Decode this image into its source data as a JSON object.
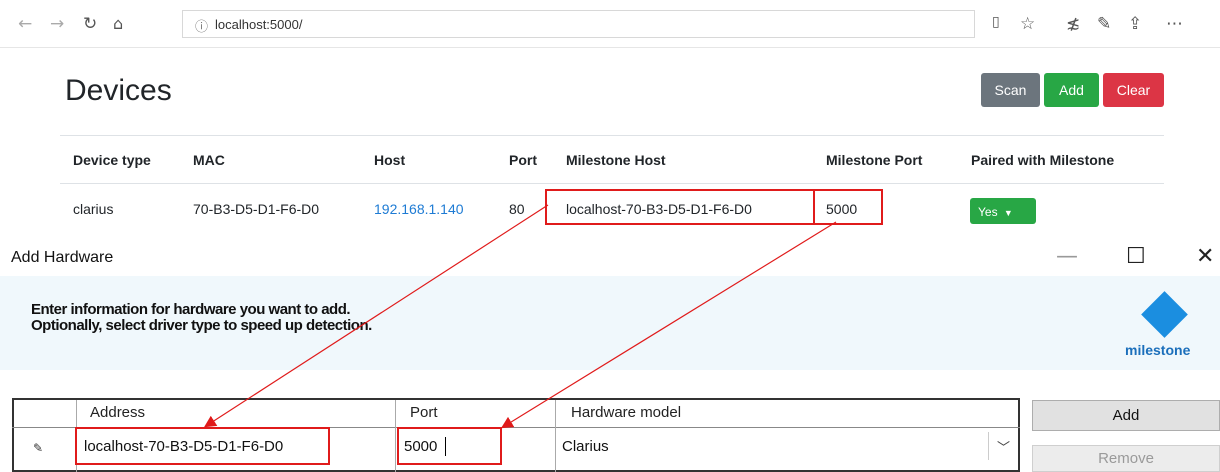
{
  "browser": {
    "url": "localhost:5000/",
    "back_icon": "back-arrow-icon",
    "forward_icon": "forward-arrow-icon",
    "refresh_icon": "refresh-icon",
    "home_icon": "home-icon"
  },
  "devices": {
    "title": "Devices",
    "buttons": {
      "scan": "Scan",
      "add": "Add",
      "clear": "Clear"
    },
    "columns": [
      "Device type",
      "MAC",
      "Host",
      "Port",
      "Milestone Host",
      "Milestone Port",
      "Paired with Milestone"
    ],
    "row": {
      "device_type": "clarius",
      "mac": "70-B3-D5-D1-F6-D0",
      "host": "192.168.1.140",
      "port": "80",
      "milestone_host": "localhost-70-B3-D5-D1-F6-D0",
      "milestone_port": "5000",
      "paired": "Yes"
    }
  },
  "dialog": {
    "title": "Add Hardware",
    "instructions_line1": "Enter information for hardware you want to add.",
    "instructions_line2": "Optionally, select driver type to speed up detection.",
    "logo_text": "milestone",
    "grid_columns": {
      "address": "Address",
      "port": "Port",
      "model": "Hardware model"
    },
    "row": {
      "address": "localhost-70-B3-D5-D1-F6-D0",
      "port": "5000",
      "model": "Clarius"
    },
    "add_button": "Add",
    "remove_button": "Remove"
  },
  "colors": {
    "highlight": "#e01b1b",
    "success": "#28a745",
    "danger": "#dc3545",
    "secondary": "#6c757d",
    "link": "#1e7bd4"
  }
}
